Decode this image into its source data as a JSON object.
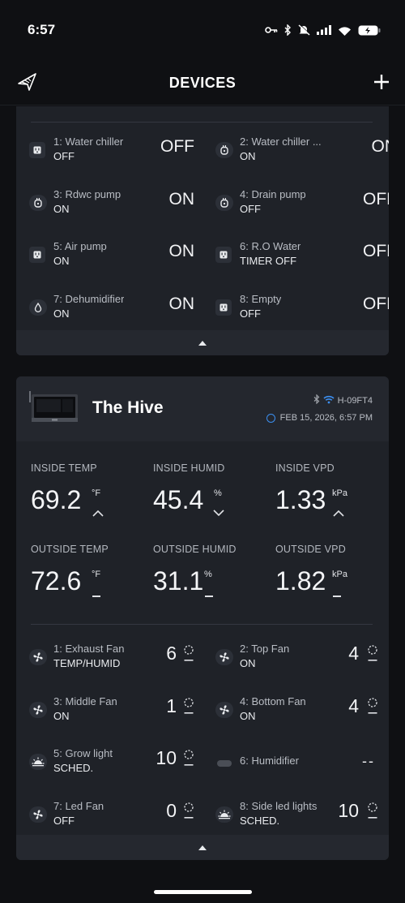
{
  "status_bar": {
    "time": "6:57"
  },
  "nav": {
    "title": "DEVICES",
    "logo_icon": "brand-logo-icon",
    "add_icon": "plus-icon"
  },
  "outlets": [
    {
      "name": "1: Water chiller",
      "mode": "OFF",
      "state": "OFF",
      "icon": "outlet-icon"
    },
    {
      "name": "2: Water chiller ...",
      "mode": "ON",
      "state": "ON",
      "icon": "plug-icon"
    },
    {
      "name": "3: Rdwc pump",
      "mode": "ON",
      "state": "ON",
      "icon": "plug-icon"
    },
    {
      "name": "4: Drain pump",
      "mode": "OFF",
      "state": "OFF",
      "icon": "plug-icon"
    },
    {
      "name": "5: Air pump",
      "mode": "ON",
      "state": "ON",
      "icon": "outlet-icon"
    },
    {
      "name": "6: R.O Water",
      "mode": "TIMER OFF",
      "state": "OFF",
      "icon": "outlet-icon"
    },
    {
      "name": "7: Dehumidifier",
      "mode": "ON",
      "state": "ON",
      "icon": "droplet-icon"
    },
    {
      "name": "8: Empty",
      "mode": "OFF",
      "state": "OFF",
      "icon": "outlet-icon"
    }
  ],
  "controller": {
    "name": "The Hive",
    "device_id": "H-09FT4",
    "timestamp": "FEB 15, 2026, 6:57 PM",
    "sensors": [
      {
        "label": "INSIDE TEMP",
        "value": "69.2",
        "unit": "°F",
        "trend": "up"
      },
      {
        "label": "INSIDE HUMID",
        "value": "45.4",
        "unit": "%",
        "trend": "down"
      },
      {
        "label": "INSIDE VPD",
        "value": "1.33",
        "unit": "kPa",
        "trend": "up"
      },
      {
        "label": "OUTSIDE TEMP",
        "value": "72.6",
        "unit": "°F",
        "trend": "flat"
      },
      {
        "label": "OUTSIDE HUMID",
        "value": "31.1",
        "unit": "%",
        "trend": "flat"
      },
      {
        "label": "OUTSIDE VPD",
        "value": "1.82",
        "unit": "kPa",
        "trend": "flat"
      }
    ],
    "ports": [
      {
        "name": "1: Exhaust Fan",
        "mode": "TEMP/HUMID",
        "level": "6",
        "icon": "fan-icon"
      },
      {
        "name": "2: Top Fan",
        "mode": "ON",
        "level": "4",
        "icon": "fan-icon"
      },
      {
        "name": "3: Middle Fan",
        "mode": "ON",
        "level": "1",
        "icon": "fan-icon"
      },
      {
        "name": "4: Bottom Fan",
        "mode": "ON",
        "level": "4",
        "icon": "fan-icon"
      },
      {
        "name": "5: Grow light",
        "mode": "SCHED.",
        "level": "10",
        "icon": "grow-light-icon"
      },
      {
        "name": "6: Humidifier",
        "mode": "",
        "level": "--",
        "icon": "empty-port-icon"
      },
      {
        "name": "7: Led Fan",
        "mode": "OFF",
        "level": "0",
        "icon": "fan-icon"
      },
      {
        "name": "8: Side led lights",
        "mode": "SCHED.",
        "level": "10",
        "icon": "grow-light-icon"
      }
    ]
  },
  "colors": {
    "background": "#0f1013",
    "card": "#1f2228",
    "accent_blue": "#3c8ff0"
  }
}
